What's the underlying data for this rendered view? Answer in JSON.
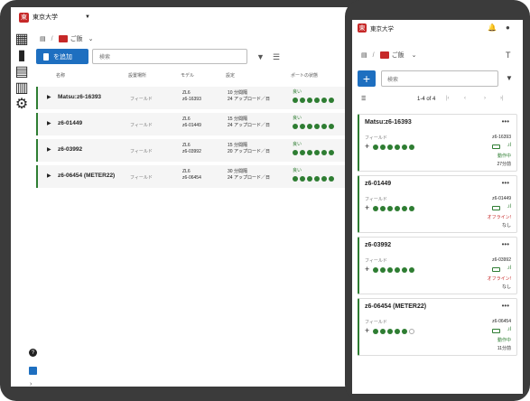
{
  "app": {
    "org": "東京大学",
    "logo": "東"
  },
  "breadcrumb": {
    "folder": "ご飯"
  },
  "toolbar": {
    "add_label": "を追加",
    "search_placeholder": "検索"
  },
  "table": {
    "headers": [
      "名称",
      "設置場所",
      "モデル",
      "設定",
      "ポートの状態"
    ],
    "rows": [
      {
        "name": "Matsu:z6-16393",
        "location": "フィールド",
        "model": "ZL6",
        "serial": "z6-16393",
        "interval": "10 分間隔",
        "upload": "24 アップロード／日",
        "status": "良い",
        "dots": 6
      },
      {
        "name": "z6-01449",
        "location": "フィールド",
        "model": "ZL6",
        "serial": "z6-01449",
        "interval": "15 分間隔",
        "upload": "24 アップロード／日",
        "status": "良い",
        "dots": 6
      },
      {
        "name": "z6-03992",
        "location": "フィールド",
        "model": "ZL6",
        "serial": "z6-03992",
        "interval": "15 分間隔",
        "upload": "20 アップロード／日",
        "status": "良い",
        "dots": 6
      },
      {
        "name": "z6-06454 (METER22)",
        "location": "フィールド",
        "model": "ZL6",
        "serial": "z6-06454",
        "interval": "30 分間隔",
        "upload": "24 アップロード／日",
        "status": "良い",
        "dots": 6
      }
    ]
  },
  "phone": {
    "pagination": "1-4 of 4",
    "cards": [
      {
        "name": "Matsu:z6-16393",
        "location": "フィールド",
        "serial": "z6-16393",
        "status": "動作中",
        "status_color": "#2e7d32",
        "time": "27分前",
        "dots": 6
      },
      {
        "name": "z6-01449",
        "location": "フィールド",
        "serial": "z6-01449",
        "status": "オフライン!",
        "status_color": "#c62828",
        "time": "なし",
        "dots": 6
      },
      {
        "name": "z6-03992",
        "location": "フィールド",
        "serial": "z6-03992",
        "status": "オフライン!",
        "status_color": "#c62828",
        "time": "なし",
        "dots": 6
      },
      {
        "name": "z6-06454 (METER22)",
        "location": "フィールド",
        "serial": "z6-06454",
        "status": "動作中",
        "status_color": "#2e7d32",
        "time": "11分前",
        "dots": 5
      }
    ]
  },
  "colors": {
    "accent": "#1e6fc0",
    "brand": "#c62828",
    "ok": "#2e7d32"
  }
}
